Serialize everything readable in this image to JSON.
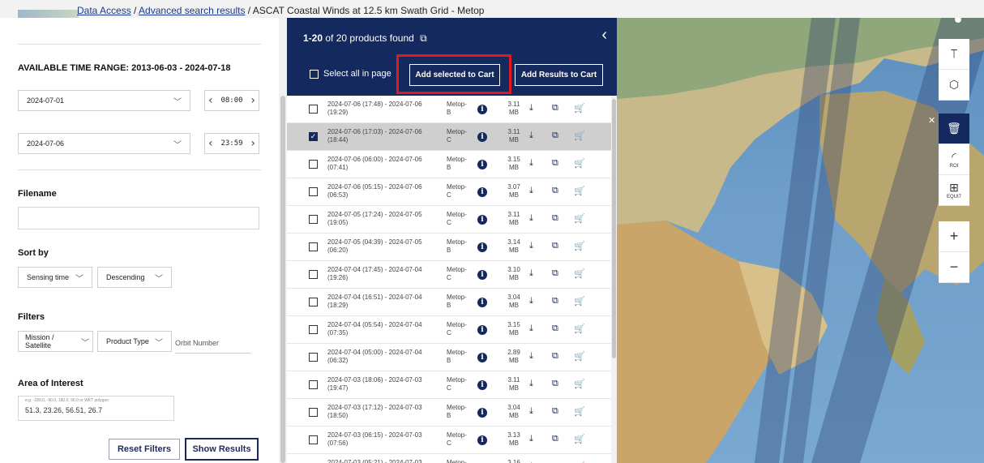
{
  "breadcrumb": {
    "link1": "Data Access",
    "sep1": " / ",
    "link2": "Advanced search results",
    "sep2": " / ",
    "current": "ASCAT Coastal Winds at 12.5 km Swath Grid - Metop"
  },
  "filters": {
    "time_range_label": "AVAILABLE TIME RANGE: 2013-06-03 - 2024-07-18",
    "start_date": "2024-07-01",
    "start_time": "08:00",
    "end_date": "2024-07-06",
    "end_time": "23:59",
    "filename_label": "Filename",
    "filename_value": "",
    "sort_label": "Sort by",
    "sort_field": "Sensing time",
    "sort_order": "Descending",
    "filters_label": "Filters",
    "mission_select": "Mission / Satellite",
    "product_type_select": "Product Type",
    "orbit_placeholder": "Orbit Number",
    "aoi_label": "Area of Interest",
    "aoi_placeholder": "e.g. -180.0, -90.0, 180.0, 90.0 or WKT polygon",
    "aoi_value": "51.3, 23.26, 56.51, 26.7",
    "reset_button": "Reset Filters",
    "show_button": "Show Results"
  },
  "results": {
    "count_bold": "1-20",
    "count_rest": "of 20 products found",
    "select_all": "Select all in page",
    "add_selected": "Add selected to Cart",
    "add_results": "Add Results to Cart",
    "rows": [
      {
        "date1": "2024-07-06 (17:48) - 2024-07-06",
        "date2": "(19:29)",
        "m1": "Metop-",
        "m2": "B",
        "s1": "3.11",
        "s2": "MB",
        "checked": false
      },
      {
        "date1": "2024-07-06 (17:03) - 2024-07-06",
        "date2": "(18:44)",
        "m1": "Metop-",
        "m2": "C",
        "s1": "3.11",
        "s2": "MB",
        "checked": true
      },
      {
        "date1": "2024-07-06 (06:00) - 2024-07-06",
        "date2": "(07:41)",
        "m1": "Metop-",
        "m2": "B",
        "s1": "3.15",
        "s2": "MB",
        "checked": false
      },
      {
        "date1": "2024-07-06 (05:15) - 2024-07-06",
        "date2": "(06:53)",
        "m1": "Metop-",
        "m2": "C",
        "s1": "3.07",
        "s2": "MB",
        "checked": false
      },
      {
        "date1": "2024-07-05 (17:24) - 2024-07-05",
        "date2": "(19:05)",
        "m1": "Metop-",
        "m2": "C",
        "s1": "3.11",
        "s2": "MB",
        "checked": false
      },
      {
        "date1": "2024-07-05 (04:39) - 2024-07-05",
        "date2": "(06:20)",
        "m1": "Metop-",
        "m2": "B",
        "s1": "3.14",
        "s2": "MB",
        "checked": false
      },
      {
        "date1": "2024-07-04 (17:45) - 2024-07-04",
        "date2": "(19:26)",
        "m1": "Metop-",
        "m2": "C",
        "s1": "3.10",
        "s2": "MB",
        "checked": false
      },
      {
        "date1": "2024-07-04 (16:51) - 2024-07-04",
        "date2": "(18:29)",
        "m1": "Metop-",
        "m2": "B",
        "s1": "3.04",
        "s2": "MB",
        "checked": false
      },
      {
        "date1": "2024-07-04 (05:54) - 2024-07-04",
        "date2": "(07:35)",
        "m1": "Metop-",
        "m2": "C",
        "s1": "3.15",
        "s2": "MB",
        "checked": false
      },
      {
        "date1": "2024-07-04 (05:00) - 2024-07-04",
        "date2": "(06:32)",
        "m1": "Metop-",
        "m2": "B",
        "s1": "2.89",
        "s2": "MB",
        "checked": false
      },
      {
        "date1": "2024-07-03 (18:06) - 2024-07-03",
        "date2": "(19:47)",
        "m1": "Metop-",
        "m2": "C",
        "s1": "3.11",
        "s2": "MB",
        "checked": false
      },
      {
        "date1": "2024-07-03 (17:12) - 2024-07-03",
        "date2": "(18:50)",
        "m1": "Metop-",
        "m2": "B",
        "s1": "3.04",
        "s2": "MB",
        "checked": false
      },
      {
        "date1": "2024-07-03 (06:15) - 2024-07-03",
        "date2": "(07:56)",
        "m1": "Metop-",
        "m2": "C",
        "s1": "3.13",
        "s2": "MB",
        "checked": false
      },
      {
        "date1": "2024-07-03 (05:21) - 2024-07-03",
        "date2": "",
        "m1": "Metop-",
        "m2": "",
        "s1": "3.16",
        "s2": "",
        "checked": false
      }
    ]
  },
  "map": {
    "roi_label": "ROI",
    "equi_label": "EQUI7",
    "zoom_in": "+",
    "zoom_out": "−"
  }
}
